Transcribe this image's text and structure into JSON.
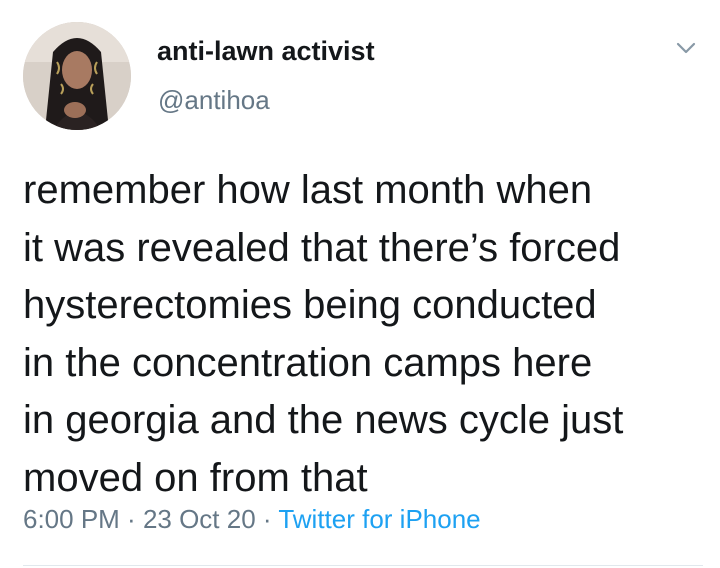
{
  "author": {
    "display_name": "anti-lawn activist",
    "handle": "@antihoa",
    "avatar_icon": "profile-photo"
  },
  "tweet": {
    "lines": [
      "remember how last month when",
      "it was revealed that there’s forced",
      "hysterectomies being conducted",
      "in the concentration camps here",
      "in georgia and the news cycle just",
      "moved on from that"
    ]
  },
  "meta": {
    "time": "6:00 PM",
    "separator": " · ",
    "date": "23 Oct 20",
    "source": "Twitter for iPhone"
  },
  "colors": {
    "text": "#14171a",
    "secondary": "#657786",
    "link": "#1da1f2",
    "divider": "#e1e8ed"
  },
  "icons": {
    "menu": "chevron-down-icon"
  }
}
